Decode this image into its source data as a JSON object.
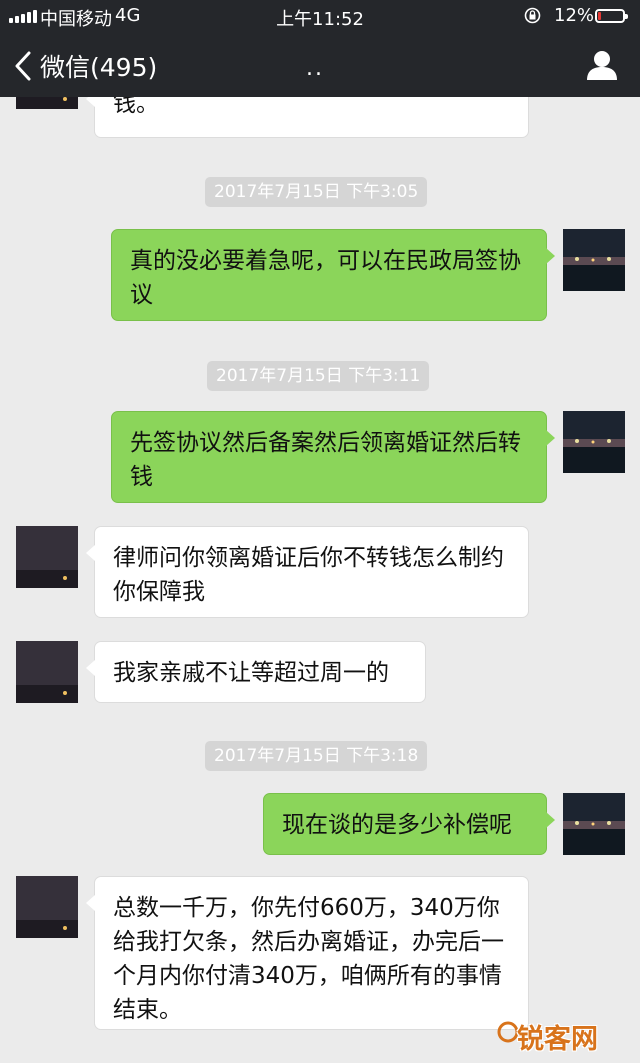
{
  "status_bar": {
    "carrier": "中国移动",
    "network": "4G",
    "time": "上午11:52",
    "battery_pct": "12%",
    "battery_level": 0.12,
    "battery_color": "#e53935"
  },
  "nav": {
    "back_label": "微信(495)",
    "back_icon": "chevron-left-icon",
    "title_dots": "..",
    "profile_icon": "person-icon"
  },
  "messages": [
    {
      "side": "recv",
      "text": "钱。"
    },
    {
      "type": "time",
      "text": "2017年7月15日 下午3:05"
    },
    {
      "side": "sent",
      "text": "真的没必要着急呢，可以在民政局签协议"
    },
    {
      "type": "time",
      "text": "2017年7月15日 下午3:11"
    },
    {
      "side": "sent",
      "text": "先签协议然后备案然后领离婚证然后转钱"
    },
    {
      "side": "recv",
      "text": "律师问你领离婚证后你不转钱怎么制约你保障我"
    },
    {
      "side": "recv",
      "text": "我家亲戚不让等超过周一的"
    },
    {
      "type": "time",
      "text": "2017年7月15日 下午3:18"
    },
    {
      "side": "sent",
      "text": "现在谈的是多少补偿呢"
    },
    {
      "side": "recv",
      "text": "总数一千万，你先付660万，340万你给我打欠条，然后办离婚证，办完后一个月内你付清340万，咱俩所有的事情结束。"
    }
  ],
  "watermark": {
    "text": "锐客网"
  }
}
